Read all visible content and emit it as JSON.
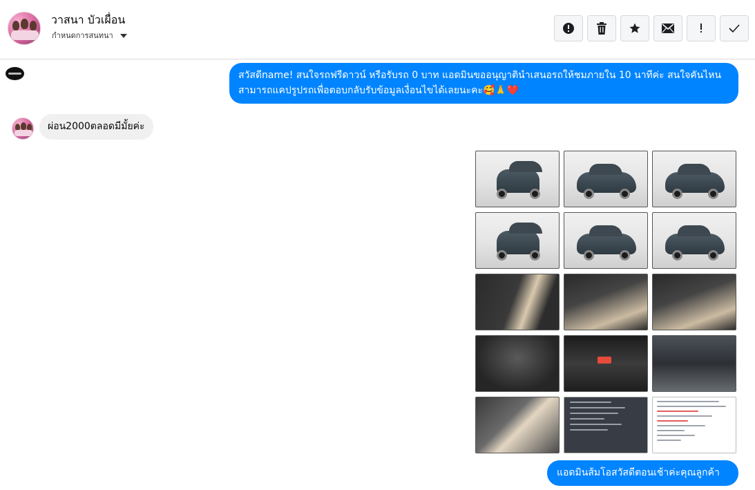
{
  "header": {
    "contact_name": "วาสนา บัวเผื่อน",
    "subtitle": "กำหนดการสนทนา",
    "avatar_icon": "profile-photo-avatar",
    "actions": [
      {
        "name": "report-button",
        "icon": "alert-circle-icon"
      },
      {
        "name": "delete-button",
        "icon": "trash-icon"
      },
      {
        "name": "star-button",
        "icon": "star-icon"
      },
      {
        "name": "mail-button",
        "icon": "envelope-icon"
      },
      {
        "name": "important-button",
        "icon": "exclamation-icon"
      },
      {
        "name": "done-button",
        "icon": "check-icon"
      }
    ]
  },
  "messages": {
    "outgoing_1": "สวัสดีname! สนใจรถฟรีดาวน์ หรือรับรถ 0 บาท แอดมินขออนุญาตินำเสนอรถให้ชมภายใน 10 นาทีค่ะ สนใจคันไหนสามารถแคปรูปรถเพื่อตอบกลับรับข้อมูลเงื่อนไขได้เลยนะคะ🥰🙏❤️",
    "incoming_1": "ผ่อน2000ตลอดมีมั้ยค่ะ",
    "outgoing_2": "แอดมินส้มโอสวัสดีตอนเช้าค่ะคุณลูกค้า"
  },
  "gallery": {
    "images": [
      {
        "kind": "studio-front",
        "desc": "car-front-photo"
      },
      {
        "kind": "studio-angle",
        "desc": "car-front-angle-photo"
      },
      {
        "kind": "studio-side",
        "desc": "car-rear-angle-photo"
      },
      {
        "kind": "studio-rear",
        "desc": "car-rear-photo"
      },
      {
        "kind": "studio-side",
        "desc": "car-side-photo"
      },
      {
        "kind": "studio-side",
        "desc": "car-side-rear-photo"
      },
      {
        "kind": "door",
        "desc": "door-panel-photo"
      },
      {
        "kind": "interior",
        "desc": "dashboard-interior-photo"
      },
      {
        "kind": "interior",
        "desc": "gear-shift-interior-photo"
      },
      {
        "kind": "engine",
        "desc": "hood-open-photo"
      },
      {
        "kind": "console",
        "desc": "center-console-photo"
      },
      {
        "kind": "engine2",
        "desc": "engine-bay-photo"
      },
      {
        "kind": "seat",
        "desc": "rear-seat-photo"
      },
      {
        "kind": "doc-dark",
        "desc": "spec-document-screenshot"
      },
      {
        "kind": "doc-light",
        "desc": "listing-post-screenshot"
      }
    ]
  },
  "colors": {
    "outgoing_bubble": "#0084ff",
    "incoming_bubble": "#f0f0f0",
    "toolbar_button_bg": "#f5f6f7"
  }
}
